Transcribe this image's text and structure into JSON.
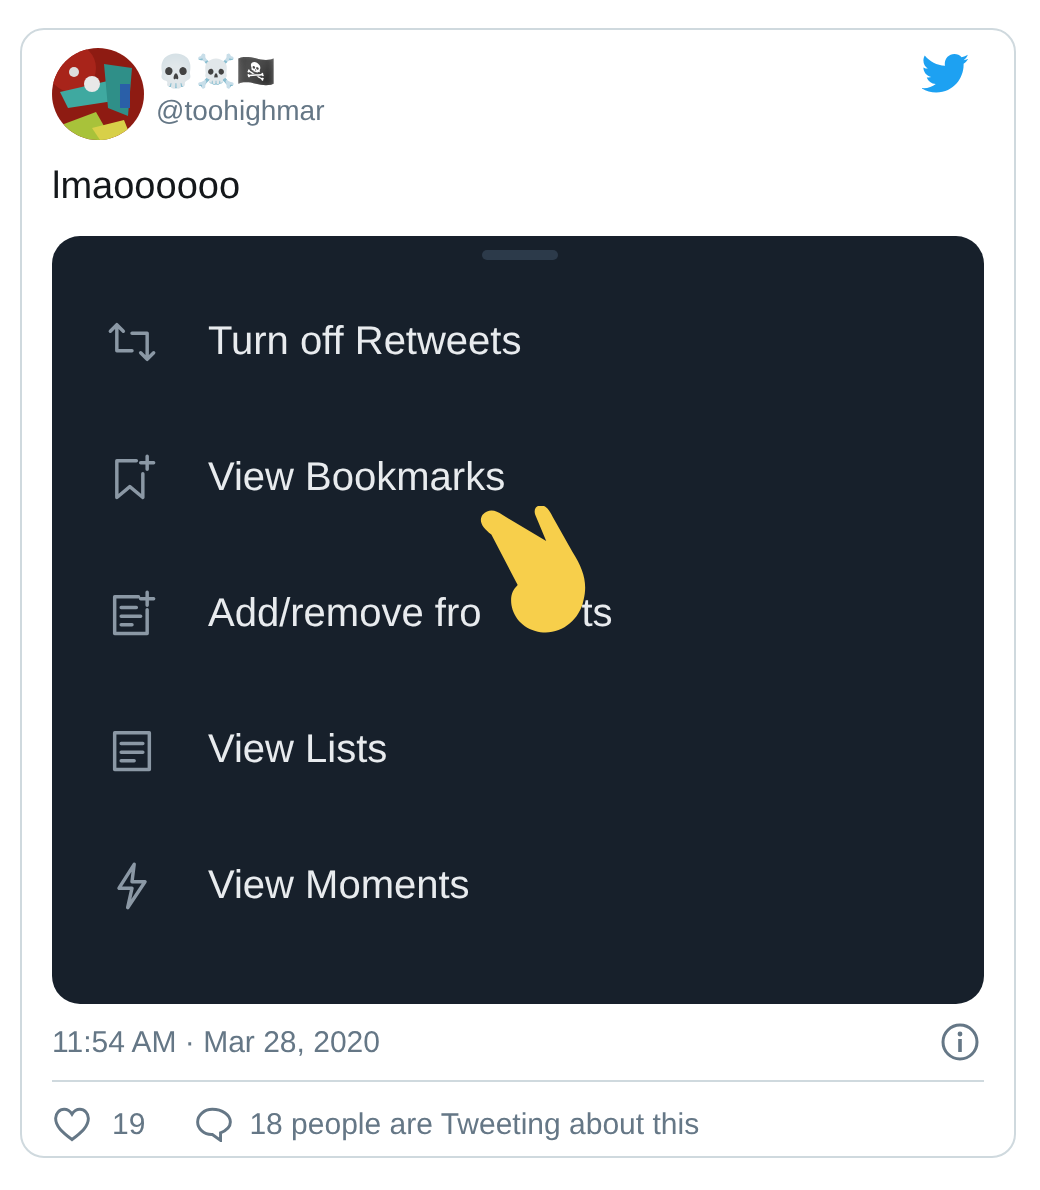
{
  "tweet": {
    "author": {
      "display_name": "💀☠️🏴‍☠️",
      "handle": "@toohighmar"
    },
    "text": "lmaoooooo",
    "media": {
      "menu_items": [
        {
          "kind": "retweet",
          "label": "Turn off Retweets"
        },
        {
          "kind": "bookmark",
          "label": "View Bookmarks"
        },
        {
          "kind": "list-add",
          "label": "Add/remove fro",
          "label_after_cover": "ts"
        },
        {
          "kind": "list",
          "label": "View Lists"
        },
        {
          "kind": "bolt",
          "label": "View Moments"
        }
      ]
    },
    "timestamp": "11:54 AM · Mar 28, 2020",
    "likes": "19",
    "conversation": "18 people are Tweeting about this"
  }
}
